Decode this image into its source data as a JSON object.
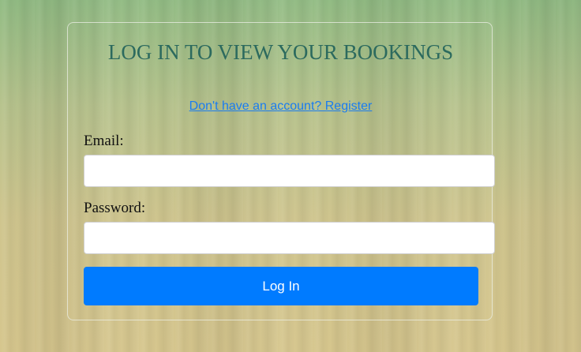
{
  "login": {
    "title": "LOG IN TO VIEW YOUR BOOKINGS",
    "register_link": "Don't have an account? Register",
    "email_label": "Email:",
    "email_value": "",
    "password_label": "Password:",
    "password_value": "",
    "submit_label": "Log In"
  },
  "colors": {
    "title": "#2c6a5e",
    "link": "#1a7cf0",
    "button": "#007bff",
    "background_top": "#92bc84",
    "background_bottom": "#d6c68d"
  }
}
